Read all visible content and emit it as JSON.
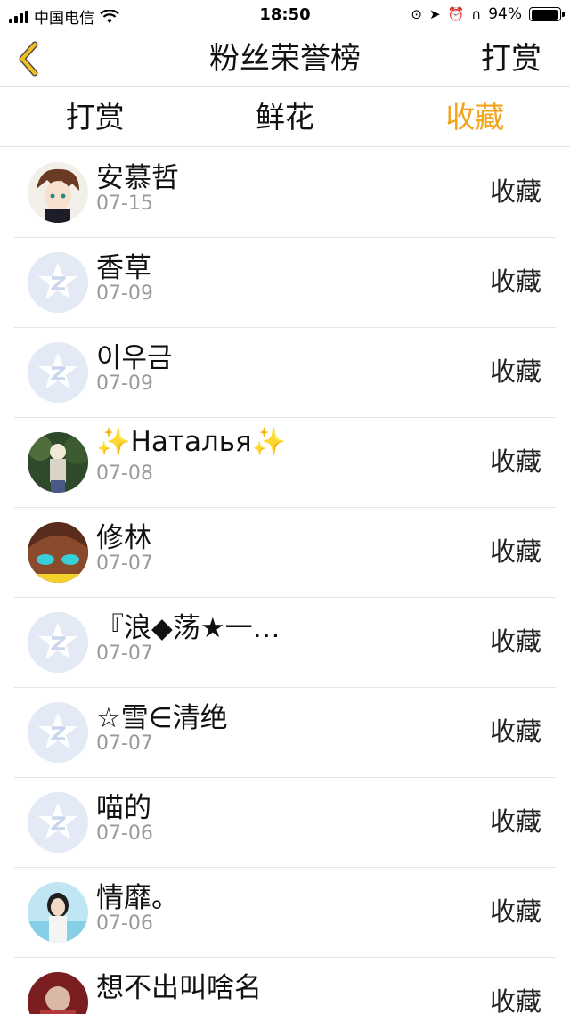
{
  "status": {
    "carrier": "中国电信",
    "time": "18:50",
    "battery": "94%",
    "battery_level": 0.94
  },
  "nav": {
    "title": "粉丝荣誉榜",
    "action": "打赏",
    "accent_color": "#f0c020"
  },
  "tabs": [
    {
      "label": "打赏"
    },
    {
      "label": "鲜花"
    },
    {
      "label": "收藏"
    }
  ],
  "active_tab_color": "#f0a51a",
  "fans": [
    {
      "name": "安慕哲",
      "date": "07-15",
      "action": "收藏",
      "avatar": "anime-boy"
    },
    {
      "name": "香草",
      "date": "07-09",
      "action": "收藏",
      "avatar": "default"
    },
    {
      "name": "이우금",
      "date": "07-09",
      "action": "收藏",
      "avatar": "default"
    },
    {
      "name": "✨Наталья✨",
      "date": "07-08",
      "action": "收藏",
      "avatar": "photo-forest"
    },
    {
      "name": "修林",
      "date": "07-07",
      "action": "收藏",
      "avatar": "anime-eyes"
    },
    {
      "name": "『浪◆荡★一…",
      "date": "07-07",
      "action": "收藏",
      "avatar": "default"
    },
    {
      "name": "☆雪∈清绝",
      "date": "07-07",
      "action": "收藏",
      "avatar": "default"
    },
    {
      "name": "喵的",
      "date": "07-06",
      "action": "收藏",
      "avatar": "default"
    },
    {
      "name": "情靡。",
      "date": "07-06",
      "action": "收藏",
      "avatar": "photo-girl"
    },
    {
      "name": "想不出叫啥名",
      "date": "",
      "action": "收藏",
      "avatar": "photo-red"
    }
  ]
}
